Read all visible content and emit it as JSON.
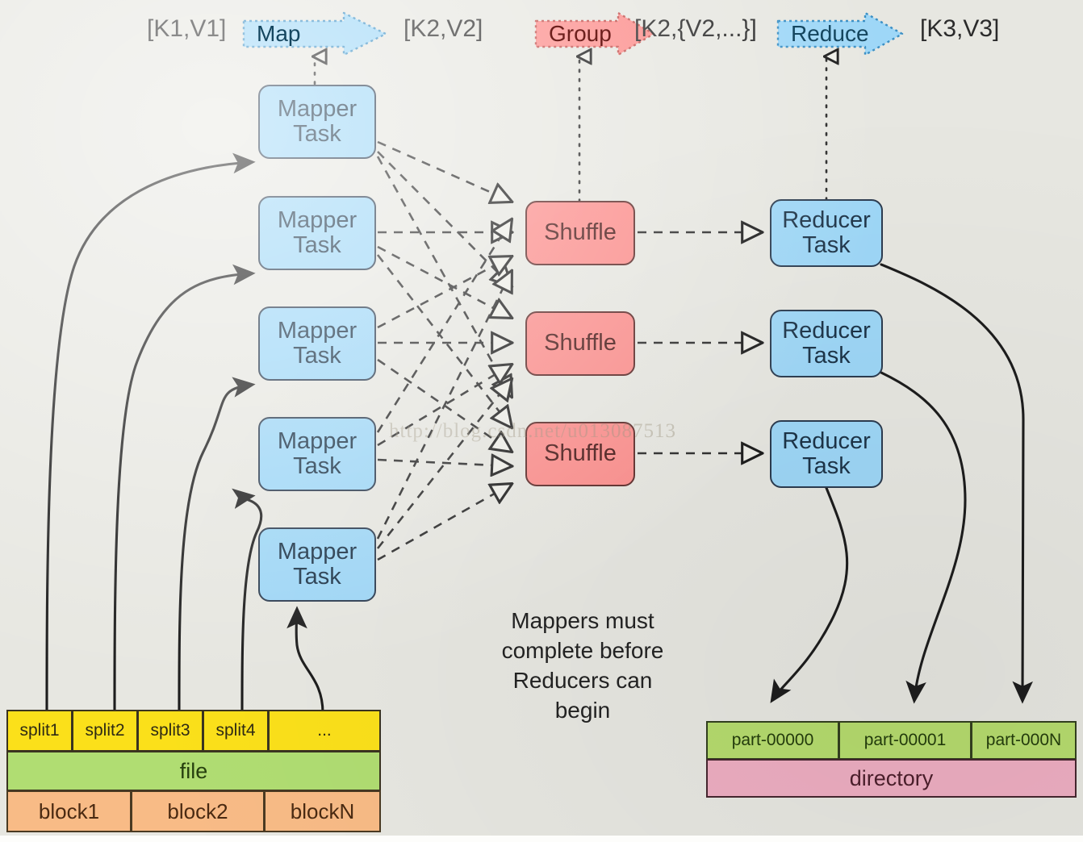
{
  "diagram": {
    "title": "MapReduce dataflow",
    "background_color": "#e7e7e1",
    "watermark": "http://blog.csdn.net/u013087513"
  },
  "banner": {
    "items": [
      {
        "kind": "label",
        "text": "[K1,V1]"
      },
      {
        "kind": "arrow",
        "text": "Map",
        "color": "blue"
      },
      {
        "kind": "label",
        "text": "[K2,V2]"
      },
      {
        "kind": "arrow",
        "text": "Group",
        "color": "red"
      },
      {
        "kind": "label",
        "text": "[K2,{V2,...}]"
      },
      {
        "kind": "arrow",
        "text": "Reduce",
        "color": "blue"
      },
      {
        "kind": "label",
        "text": "[K3,V3]"
      }
    ],
    "blue_fill": "#9ed7f7",
    "red_fill": "#fc8e8c"
  },
  "mappers": {
    "label": "Mapper\nTask",
    "count": 5,
    "fill": "#9ed7f7",
    "stroke": "#2c3c50",
    "items": [
      {
        "label": "Mapper\nTask"
      },
      {
        "label": "Mapper\nTask"
      },
      {
        "label": "Mapper\nTask"
      },
      {
        "label": "Mapper\nTask"
      },
      {
        "label": "Mapper\nTask"
      }
    ]
  },
  "shuffles": {
    "label": "Shuffle",
    "count": 3,
    "fill": "#fc8e8c",
    "stroke": "#5c2a28",
    "items": [
      {
        "label": "Shuffle"
      },
      {
        "label": "Shuffle"
      },
      {
        "label": "Shuffle"
      }
    ]
  },
  "reducers": {
    "label": "Reducer\nTask",
    "count": 3,
    "fill": "#9ed7f7",
    "stroke": "#2c3c50",
    "items": [
      {
        "label": "Reducer\nTask"
      },
      {
        "label": "Reducer\nTask"
      },
      {
        "label": "Reducer\nTask"
      }
    ]
  },
  "caption": {
    "text": "Mappers must\ncomplete before\nReducers can\nbegin"
  },
  "input_store": {
    "splits": [
      {
        "label": "split1"
      },
      {
        "label": "split2"
      },
      {
        "label": "split3"
      },
      {
        "label": "split4"
      },
      {
        "label": "..."
      }
    ],
    "file": {
      "label": "file"
    },
    "blocks": [
      {
        "label": "block1"
      },
      {
        "label": "block2"
      },
      {
        "label": "blockN"
      }
    ],
    "colors": {
      "split": "#fbe01a",
      "file": "#b0dd72",
      "block": "#f8bb86"
    }
  },
  "output_store": {
    "parts": [
      {
        "label": "part-00000"
      },
      {
        "label": "part-00001"
      },
      {
        "label": "part-000N"
      }
    ],
    "directory": {
      "label": "directory"
    },
    "colors": {
      "part": "#b6dc6e",
      "directory": "#eeaec2"
    }
  }
}
